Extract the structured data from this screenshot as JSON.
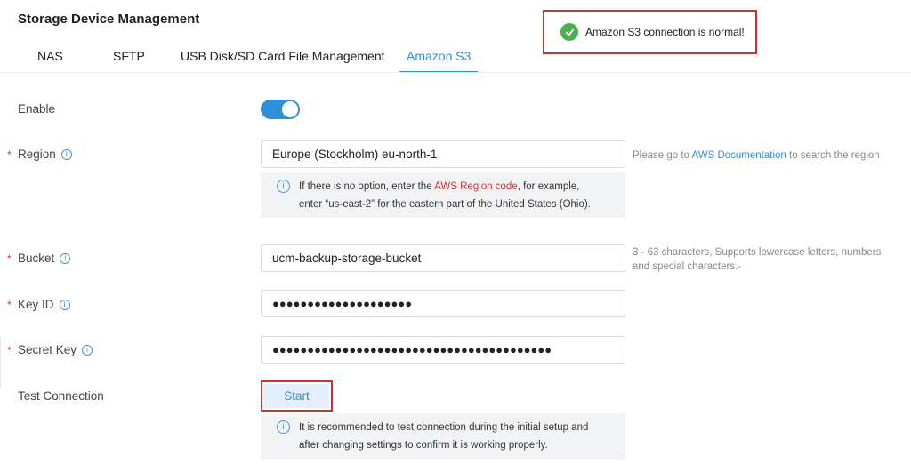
{
  "header": {
    "title": "Storage Device Management"
  },
  "tabs": [
    {
      "label": "NAS"
    },
    {
      "label": "SFTP"
    },
    {
      "label": "USB Disk/SD Card File Management"
    },
    {
      "label": "Amazon S3"
    }
  ],
  "toast": {
    "message": "Amazon S3 connection is normal!",
    "icon": "check-circle-icon",
    "color": "#4caf50"
  },
  "form": {
    "enable": {
      "label": "Enable",
      "value": true
    },
    "region": {
      "label": "Region",
      "value": "Europe (Stockholm) eu-north-1",
      "help_prefix": "Please go to ",
      "help_link": "AWS Documentation",
      "help_suffix": " to search the region",
      "note_line1_prefix": "If there is no option, enter the ",
      "note_line1_link": "AWS Region code",
      "note_line1_suffix": ", for example,",
      "note_line2": "enter “us-east-2” for the eastern part of the United States (Ohio)."
    },
    "bucket": {
      "label": "Bucket",
      "value": "ucm-backup-storage-bucket",
      "help_line1": "3 - 63 characters, Supports lowercase letters, numbers",
      "help_line2": "and special characters.-"
    },
    "key_id": {
      "label": "Key ID",
      "value": "●●●●●●●●●●●●●●●●●●●●"
    },
    "secret_key": {
      "label": "Secret Key",
      "value": "●●●●●●●●●●●●●●●●●●●●●●●●●●●●●●●●●●●●●●●●"
    },
    "test_connection": {
      "label": "Test Connection",
      "button": "Start",
      "note_line1": "It is recommended to test connection during the initial setup and",
      "note_line2": "after changing settings to confirm it is working properly."
    },
    "required_mark": "*",
    "info_glyph": "i"
  },
  "colors": {
    "accent": "#2f8fd8",
    "highlight_border": "#d32f2f",
    "required": "#d9363e"
  }
}
